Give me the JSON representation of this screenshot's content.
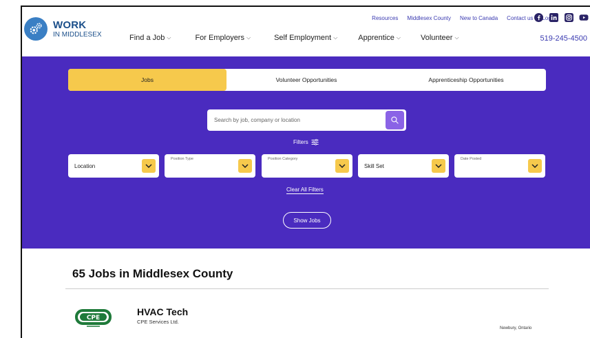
{
  "header": {
    "logo": {
      "brand": "WORK",
      "sub": "IN MIDDLESEX"
    },
    "top_links": [
      "Resources",
      "Middlesex County",
      "New to Canada",
      "Contact us",
      "Login"
    ],
    "social_icons": [
      "facebook-icon",
      "linkedin-icon",
      "instagram-icon",
      "youtube-icon"
    ],
    "nav": [
      {
        "label": "Find a Job"
      },
      {
        "label": "For Employers"
      },
      {
        "label": "Self Employment"
      },
      {
        "label": "Apprentice"
      },
      {
        "label": "Volunteer"
      }
    ],
    "phone": "519-245-4500"
  },
  "hero": {
    "bg_color": "#4a2bbf",
    "accent_color": "#f6c94c",
    "tabs": [
      {
        "label": "Jobs",
        "active": true
      },
      {
        "label": "Volunteer Opportunities",
        "active": false
      },
      {
        "label": "Apprenticeship Opportunities",
        "active": false
      }
    ],
    "search": {
      "placeholder": "Search by job, company or location"
    },
    "filters_label": "Filters",
    "dropdowns": [
      {
        "top_label": "",
        "value": "Location"
      },
      {
        "top_label": "Position Type",
        "value": ""
      },
      {
        "top_label": "Position Category",
        "value": ""
      },
      {
        "top_label": "",
        "value": "Skill Set"
      },
      {
        "top_label": "Date Posted",
        "value": ""
      }
    ],
    "clear_label": "Clear All Filters",
    "show_label": "Show Jobs"
  },
  "results": {
    "title": "65 Jobs in Middlesex County",
    "jobs": [
      {
        "logo_text": "CPE",
        "title": "HVAC Tech",
        "company": "CPE Services Ltd.",
        "location": "Newbury, Ontario"
      }
    ]
  }
}
